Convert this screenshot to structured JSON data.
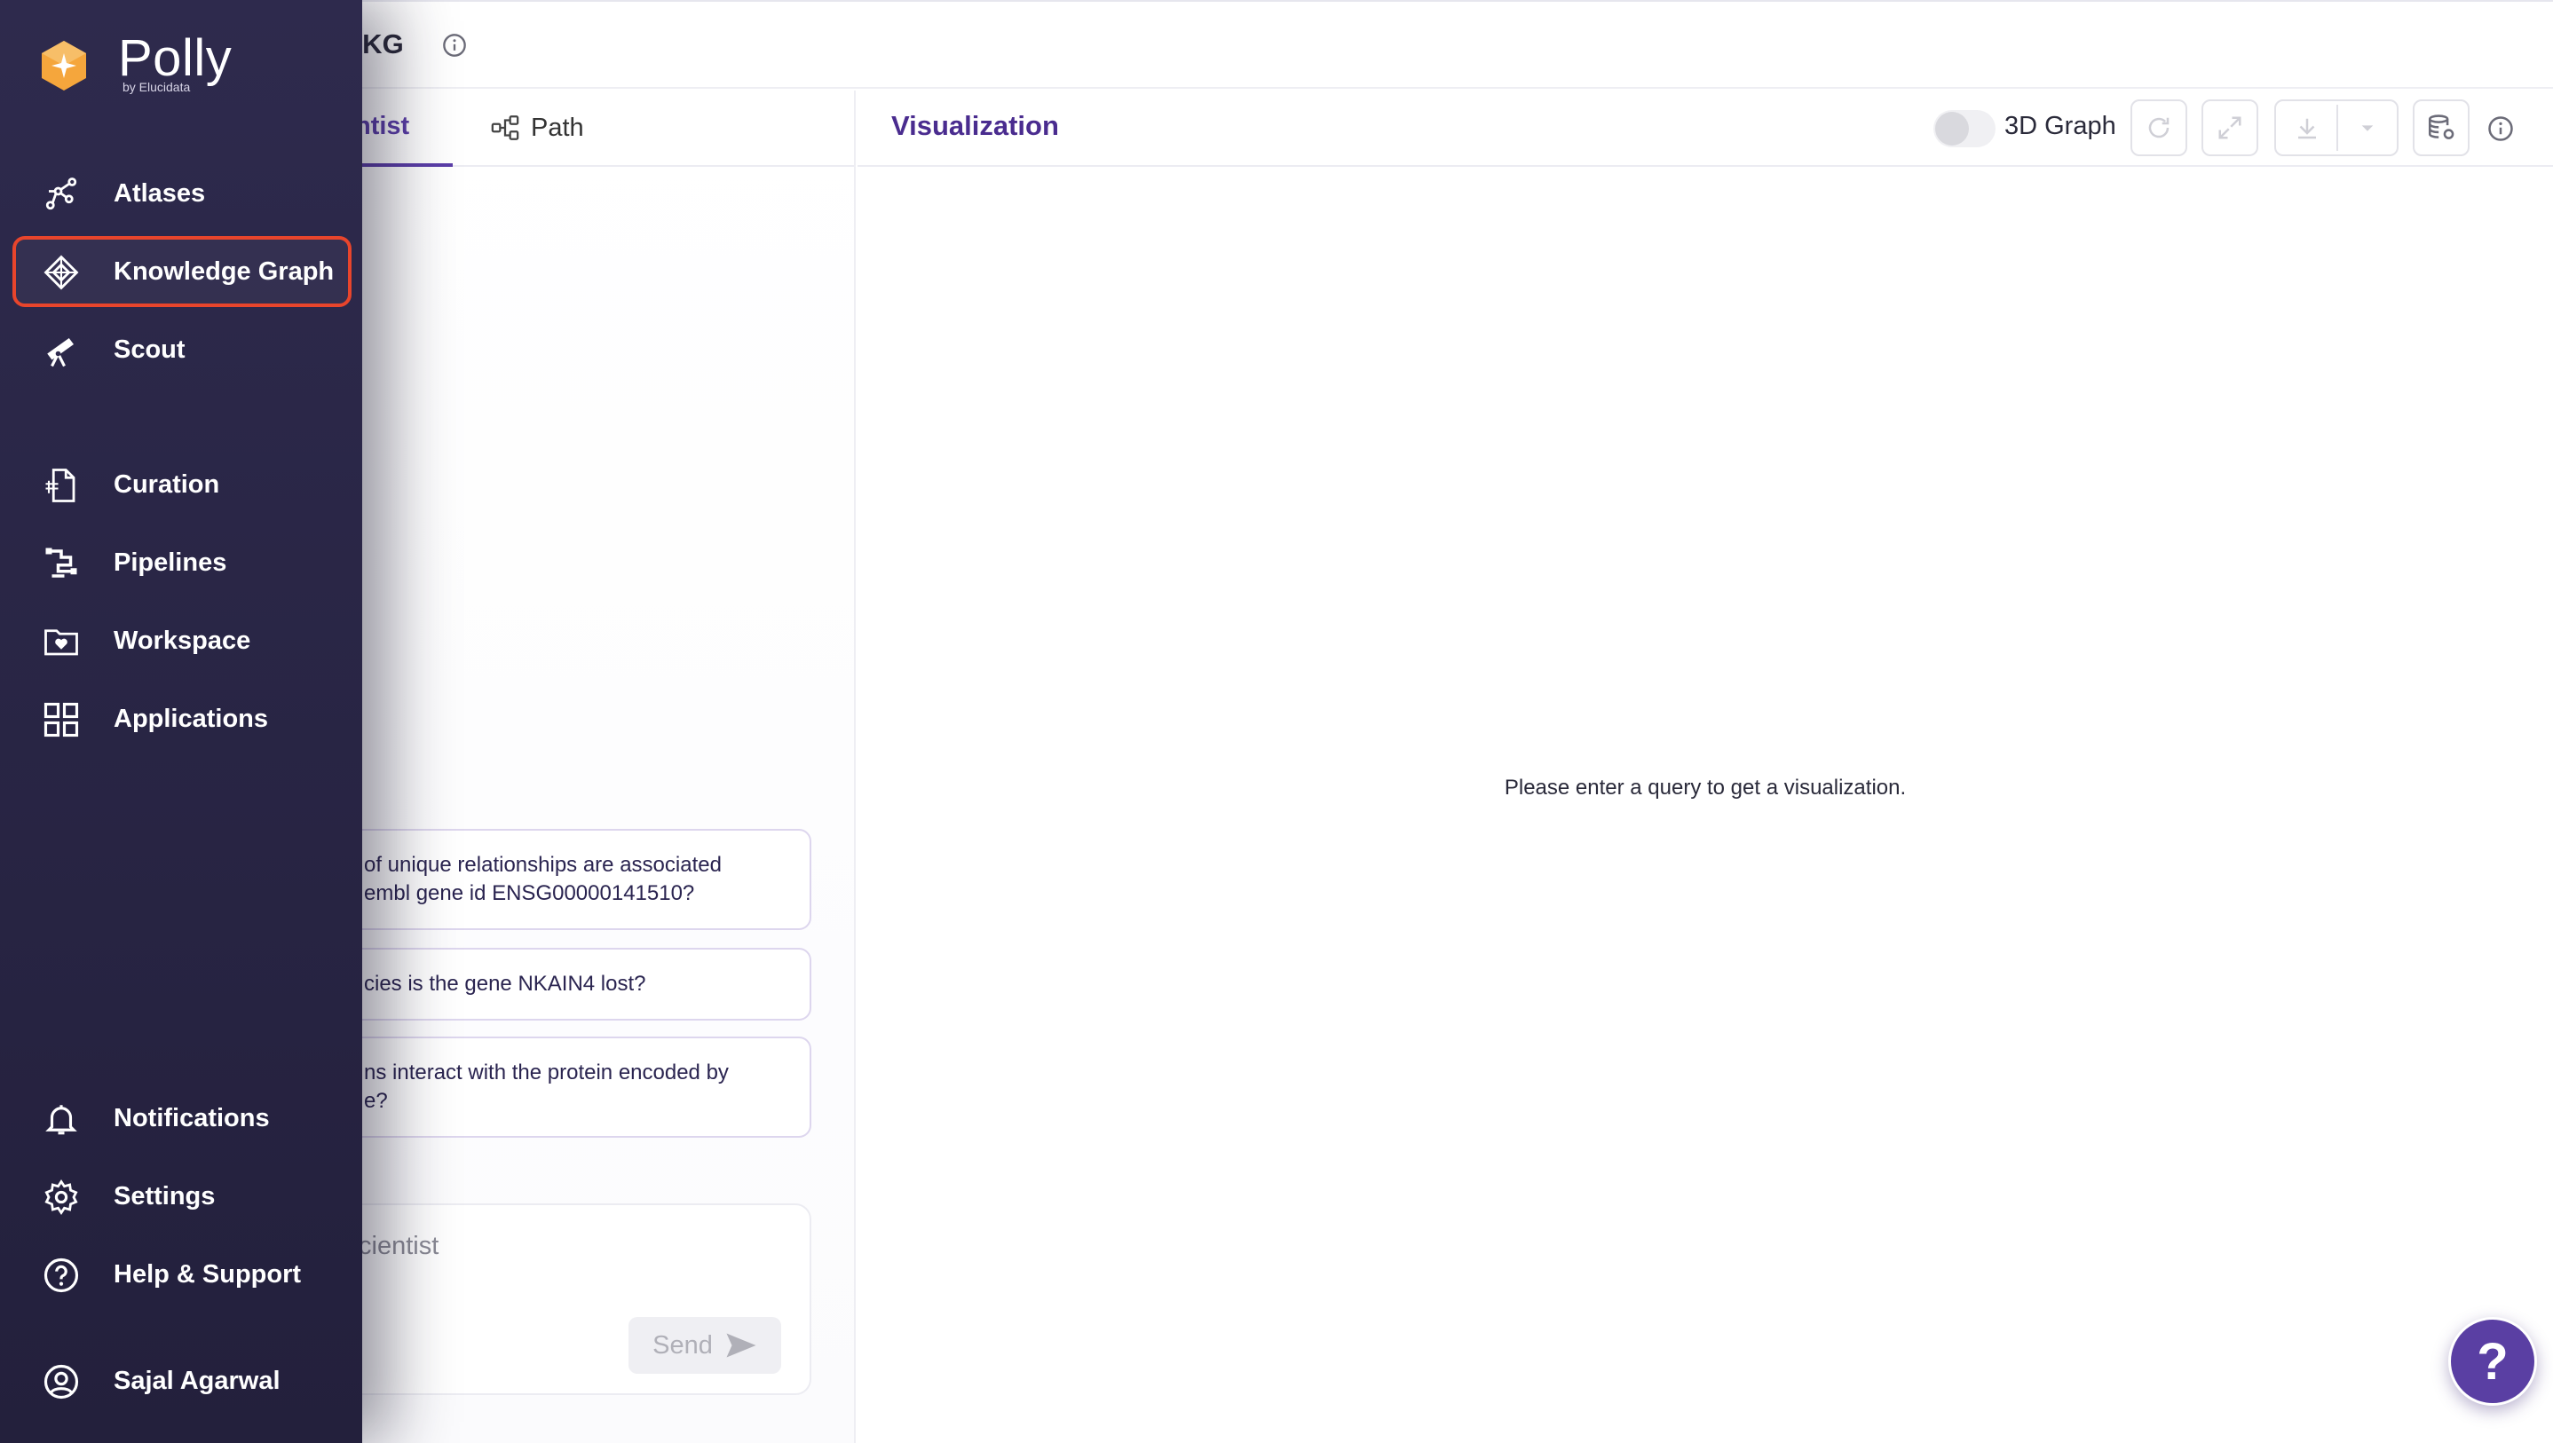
{
  "app": {
    "brand": "Polly",
    "brand_sub": "by Elucidata",
    "page_title": "m KG"
  },
  "sidebar": {
    "items": [
      {
        "label": "Atlases",
        "icon": "atlas-icon"
      },
      {
        "label": "Knowledge Graph",
        "icon": "knowledge-graph-icon",
        "active": true
      },
      {
        "label": "Scout",
        "icon": "telescope-icon"
      },
      {
        "label": "Curation",
        "icon": "curation-icon"
      },
      {
        "label": "Pipelines",
        "icon": "pipelines-icon"
      },
      {
        "label": "Workspace",
        "icon": "workspace-icon"
      },
      {
        "label": "Applications",
        "icon": "applications-grid-icon"
      }
    ],
    "bottom": [
      {
        "label": "Notifications",
        "icon": "bell-icon"
      },
      {
        "label": "Settings",
        "icon": "gear-icon"
      },
      {
        "label": "Help & Support",
        "icon": "help-circle-icon"
      },
      {
        "label": "Sajal Agarwal",
        "icon": "user-avatar-icon"
      }
    ],
    "accent_color": "#e8452c"
  },
  "left_panel": {
    "tabs": [
      {
        "label": "ntist",
        "active": true
      },
      {
        "label": "Path",
        "active": false
      }
    ],
    "suggestions": [
      {
        "line1": "of unique relationships are associated",
        "line2": "embl gene id ENSG00000141510?"
      },
      {
        "line1": "cies is the gene NKAIN4 lost?"
      },
      {
        "line1": "ns interact with the protein encoded by",
        "line2": "e?"
      }
    ],
    "input": {
      "placeholder": "cientist",
      "send_label": "Send"
    }
  },
  "viz": {
    "title": "Visualization",
    "toggle_label": "3D Graph",
    "toggle_on": false,
    "empty_message": "Please enter a query to get a visualization."
  },
  "help_fab": {
    "label": "?"
  },
  "colors": {
    "brand_purple": "#5b3ea8",
    "sidebar_bg": "#2e2a4d",
    "logo_orange": "#f5a63c",
    "active_outline": "#e8452c"
  }
}
